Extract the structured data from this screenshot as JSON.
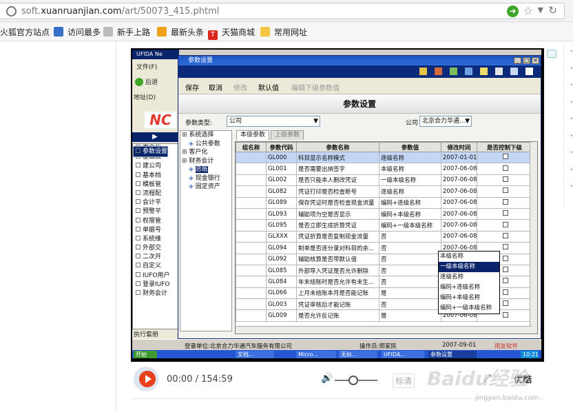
{
  "browser": {
    "url_domain_prefix": "soft.",
    "url_domain_main": "xuanruanjian.com",
    "url_path": "/art/50073_415.phtml",
    "bookmarks": [
      {
        "label": "火狐官方站点",
        "color": "#e06a1a"
      },
      {
        "label": "访问最多",
        "color": "#3a6fc8"
      },
      {
        "label": "新手上路",
        "color": "#bbbbbb"
      },
      {
        "label": "最新头条",
        "color": "#f0a11a"
      },
      {
        "label": "天猫商城",
        "color": "#d8261d",
        "glyph": "T"
      },
      {
        "label": "常用网址",
        "color": "#f4c542"
      }
    ]
  },
  "side_bullets": [
    "·",
    "·",
    "·",
    "·",
    "·",
    "·",
    "·",
    "·",
    "·"
  ],
  "video": {
    "bg_app_title": "UFIDA Ne",
    "bg_menu": "文件(F)",
    "bg_back": "后退",
    "bg_address": "地址(D)",
    "bg_tree": [
      {
        "label": "客户化",
        "selected": false
      },
      {
        "label": "参数设置",
        "selected": true
      },
      {
        "label": "基础数",
        "selected": false
      },
      {
        "label": "建公司",
        "selected": false
      },
      {
        "label": "基本档",
        "selected": false
      },
      {
        "label": "模板管",
        "selected": false
      },
      {
        "label": "流程配",
        "selected": false
      },
      {
        "label": "会计平",
        "selected": false
      },
      {
        "label": "预警平",
        "selected": false
      },
      {
        "label": "权限管",
        "selected": false
      },
      {
        "label": "单据号",
        "selected": false
      },
      {
        "label": "系统维",
        "selected": false
      },
      {
        "label": "外部交",
        "selected": false
      },
      {
        "label": "二次开",
        "selected": false
      },
      {
        "label": "自定义",
        "selected": false
      },
      {
        "label": "IUFO用户",
        "selected": false
      },
      {
        "label": "登录IUFO",
        "selected": false
      },
      {
        "label": "财务会计",
        "selected": false
      }
    ],
    "bg_bottom_label": "执行套册",
    "window_title": "参数设置",
    "toolbar": {
      "save": "保存",
      "cancel": "取消",
      "edit": "修改",
      "default": "默认值",
      "edit_lower": "编辑下级参数值"
    },
    "header": "参数设置",
    "param_type_label": "参数类型:",
    "param_type_value": "公司",
    "company_label": "公司",
    "company_value": "北京合力华通...",
    "left_tree": [
      {
        "label": "系统选择",
        "indent": 0,
        "hi": false
      },
      {
        "label": "公共参数",
        "indent": 1,
        "hi": false
      },
      {
        "label": "客户化",
        "indent": 0,
        "hi": false
      },
      {
        "label": "财务会计",
        "indent": 0,
        "hi": false
      },
      {
        "label": "总账",
        "indent": 1,
        "hi": true
      },
      {
        "label": "现金银行",
        "indent": 1,
        "hi": false
      },
      {
        "label": "固定资产",
        "indent": 1,
        "hi": false
      }
    ],
    "tabs": [
      "本级参数",
      "上级参数"
    ],
    "columns": [
      "组名称",
      "参数代码",
      "参数名称",
      "参数值",
      "修改时间",
      "是否控制下级"
    ],
    "rows": [
      {
        "code": "GL000",
        "name": "科目显示名称模式",
        "value": "逐级名称",
        "date": "2007-01-01",
        "sel": true
      },
      {
        "code": "GL001",
        "name": "是否需要出纳签字",
        "value": "本级名称",
        "date": "2007-06-08",
        "sel": false
      },
      {
        "code": "GL002",
        "name": "是否只能本人删改凭证",
        "value": "一级本级名称",
        "date": "2007-06-08",
        "sel": false
      },
      {
        "code": "GL082",
        "name": "凭证打印是否检查断号",
        "value": "逐级名称",
        "date": "2007-06-08",
        "sel": false
      },
      {
        "code": "GL089",
        "name": "保存凭证时是否检查现金流量",
        "value": "编码+逐级名称",
        "date": "2007-06-08",
        "sel": false
      },
      {
        "code": "GL093",
        "name": "辅助项为空是否显示",
        "value": "编码+本级名称",
        "date": "2007-06-08",
        "sel": false
      },
      {
        "code": "GL095",
        "name": "是否立即生成折算凭证",
        "value": "编码+一级本级名称",
        "date": "2007-06-08",
        "sel": false
      },
      {
        "code": "GLXXX",
        "name": "凭证折算是否复制现金流量",
        "value": "否",
        "date": "2007-06-08",
        "sel": false
      },
      {
        "code": "GL094",
        "name": "制单是否逐分录对科目的余...",
        "value": "否",
        "date": "2007-06-08",
        "sel": false
      },
      {
        "code": "GL092",
        "name": "辅助核算是否带默认值",
        "value": "否",
        "date": "2007-06-08",
        "sel": false
      },
      {
        "code": "GL085",
        "name": "外部导入凭证是否允许删除",
        "value": "否",
        "date": "2007-06-08",
        "sel": false
      },
      {
        "code": "GL084",
        "name": "年末结账时是否允许有未生...",
        "value": "否",
        "date": "2007-06-08",
        "sel": false
      },
      {
        "code": "GL066",
        "name": "上月未结账本月是否能记账",
        "value": "是",
        "date": "2007-06-08",
        "sel": false
      },
      {
        "code": "GL003",
        "name": "凭证审核后才能记账",
        "value": "否",
        "date": "2007-06-08",
        "sel": false
      },
      {
        "code": "GL009",
        "name": "是否允许反记账",
        "value": "是",
        "date": "2007-06-08",
        "sel": false
      }
    ],
    "dropdown_options": [
      "本级名称",
      "一级本级名称",
      "逐级名称",
      "编码+逐级名称",
      "编码+本级名称",
      "编码+一级本级名称"
    ],
    "status": {
      "unit": "登录单位:北京合力华通汽车服务有限公司",
      "operator": "操作员:郑家民",
      "date": "2007-09-01",
      "brand": "用友软件"
    },
    "taskbar": [
      {
        "label": "开始"
      },
      {
        "label": "文档..."
      },
      {
        "label": "Micro..."
      },
      {
        "label": "无标..."
      },
      {
        "label": "UFIDA..."
      },
      {
        "label": "参数设置"
      }
    ],
    "clock": "10:21"
  },
  "player": {
    "time": "00:00 / 154:59",
    "quality": "标清",
    "brand": "优酷"
  },
  "watermark": "Baidu经验",
  "watermark_url": "jingyan.baidu.com"
}
